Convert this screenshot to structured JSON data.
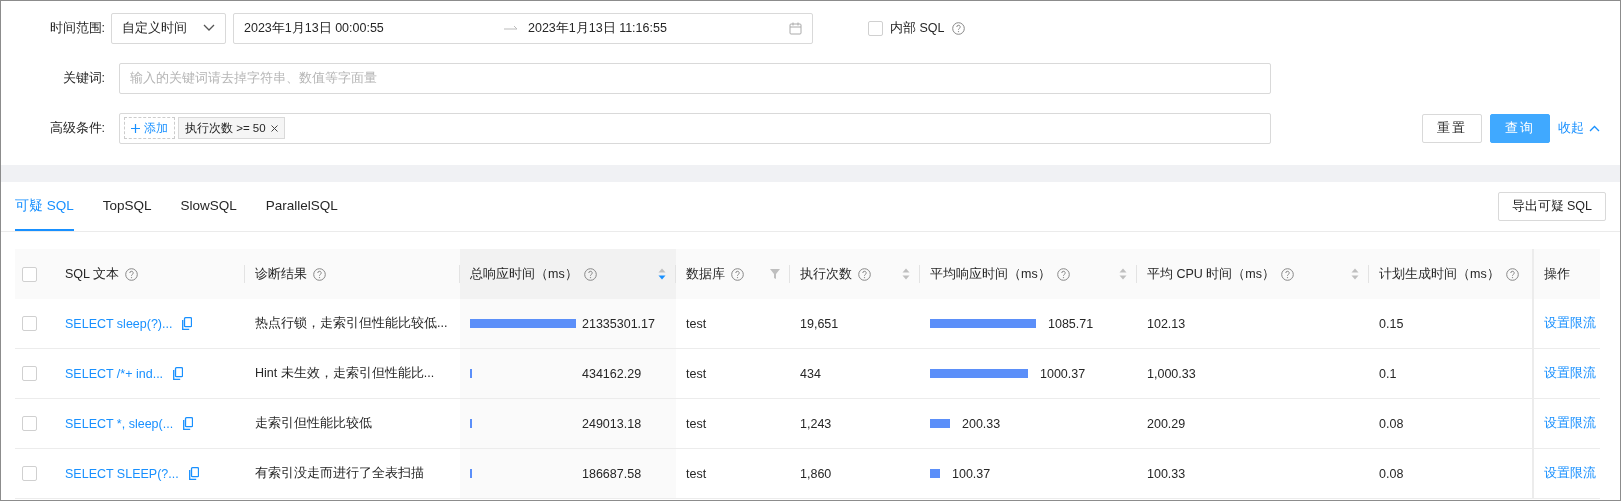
{
  "filters": {
    "time_range": {
      "label": "时间范围:",
      "mode": "自定义时间",
      "start": "2023年1月13日 00:00:55",
      "end": "2023年1月13日 11:16:55"
    },
    "internal_sql": {
      "label": "内部 SQL",
      "checked": false
    },
    "keyword": {
      "label": "关键词:",
      "placeholder": "输入的关键词请去掉字符串、数值等字面量"
    },
    "advanced": {
      "label": "高级条件:",
      "add_label": "添加",
      "conditions": [
        "执行次数 >= 50"
      ]
    },
    "buttons": {
      "reset": "重置",
      "query": "查询",
      "collapse": "收起"
    }
  },
  "tabs": [
    {
      "label": "可疑 SQL",
      "selected": true
    },
    {
      "label": "TopSQL",
      "selected": false
    },
    {
      "label": "SlowSQL",
      "selected": false
    },
    {
      "label": "ParallelSQL",
      "selected": false
    }
  ],
  "export_button": "导出可疑 SQL",
  "table": {
    "select_all_checked": false,
    "columns": [
      {
        "label": "SQL 文本",
        "help": true,
        "kind": "plain"
      },
      {
        "label": "诊断结果",
        "help": true,
        "kind": "plain"
      },
      {
        "label": "总响应时间（ms）",
        "help": true,
        "kind": "sort",
        "sorted": true
      },
      {
        "label": "数据库",
        "help": true,
        "kind": "filter"
      },
      {
        "label": "执行次数",
        "help": true,
        "kind": "sort",
        "sorted": false
      },
      {
        "label": "平均响应时间（ms）",
        "help": true,
        "kind": "sort",
        "sorted": false
      },
      {
        "label": "平均 CPU 时间（ms）",
        "help": true,
        "kind": "sort",
        "sorted": false
      },
      {
        "label": "计划生成时间（ms）",
        "help": true,
        "kind": "plain"
      },
      {
        "label": "操作",
        "help": false,
        "kind": "plain"
      }
    ],
    "rows": [
      {
        "checked": false,
        "sql": "SELECT sleep(?)...",
        "diagnosis": "热点行锁，走索引但性能比较低...",
        "total": "21335301.17",
        "database": "test",
        "exec_count": "19,651",
        "avg_resp": "1085.71",
        "avg_cpu": "102.13",
        "plan_time": "0.15",
        "action": "设置限流"
      },
      {
        "checked": false,
        "sql": "SELECT /*+ ind...",
        "diagnosis": "Hint 未生效，走索引但性能比...",
        "total": "434162.29",
        "database": "test",
        "exec_count": "434",
        "avg_resp": "1000.37",
        "avg_cpu": "1,000.33",
        "plan_time": "0.1",
        "action": "设置限流"
      },
      {
        "checked": false,
        "sql": "SELECT *, sleep(...",
        "diagnosis": "走索引但性能比较低",
        "total": "249013.18",
        "database": "test",
        "exec_count": "1,243",
        "avg_resp": "200.33",
        "avg_cpu": "200.29",
        "plan_time": "0.08",
        "action": "设置限流"
      },
      {
        "checked": false,
        "sql": "SELECT SLEEP(?...",
        "diagnosis": "有索引没走而进行了全表扫描",
        "total": "186687.58",
        "database": "test",
        "exec_count": "1,860",
        "avg_resp": "100.37",
        "avg_cpu": "100.33",
        "plan_time": "0.08",
        "action": "设置限流"
      }
    ]
  }
}
